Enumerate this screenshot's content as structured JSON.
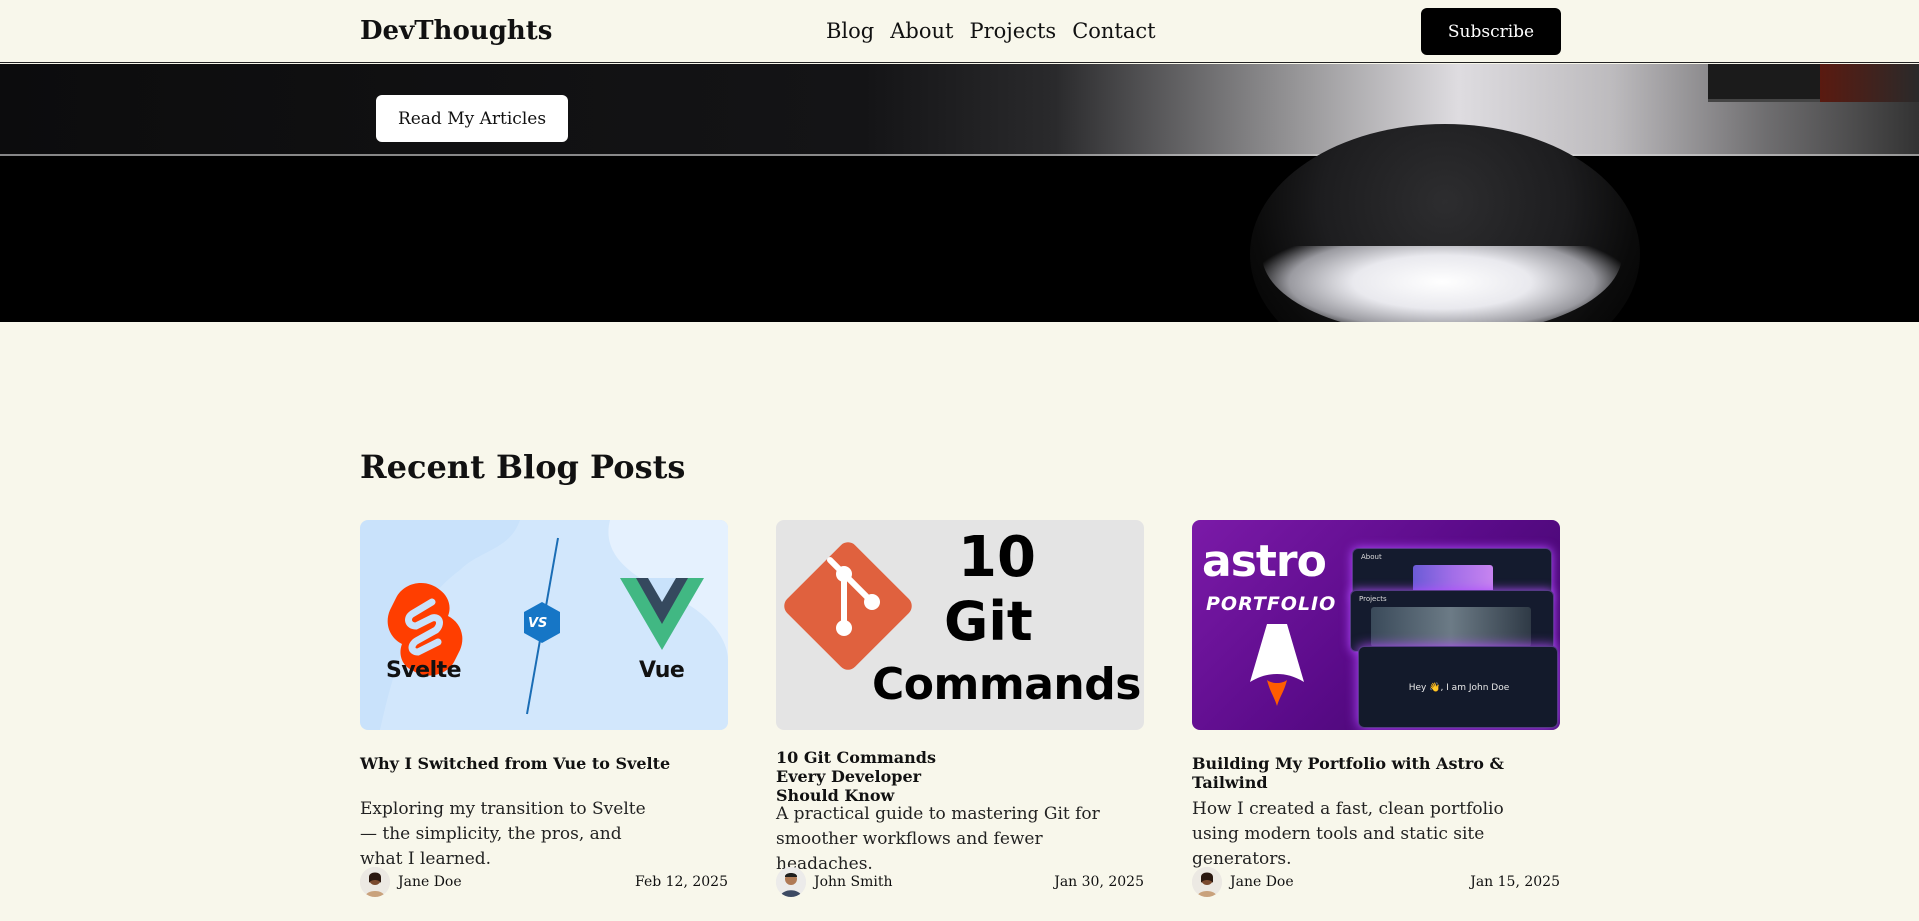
{
  "header": {
    "brand": "DevThoughts",
    "nav": [
      "Blog",
      "About",
      "Projects",
      "Contact"
    ],
    "subscribe_label": "Subscribe"
  },
  "hero": {
    "cta_label": "Read My Articles"
  },
  "section": {
    "title": "Recent Blog Posts"
  },
  "posts": [
    {
      "title": "Why I Switched from Vue to Svelte",
      "description": "Exploring my transition to Svelte — the simplicity, the pros, and what I learned.",
      "author": "Jane Doe",
      "date": "Feb 12, 2025",
      "thumb": {
        "left_label": "Svelte",
        "mid_label": "VS",
        "right_label": "Vue"
      }
    },
    {
      "title": "10 Git Commands Every Developer Should Know",
      "description": "A practical guide to mastering Git for smoother workflows and fewer headaches.",
      "author": "John Smith",
      "date": "Jan 30, 2025",
      "thumb": {
        "line1": "10",
        "line2": "Git",
        "line3": "Commands"
      }
    },
    {
      "title": "Building My Portfolio with Astro & Tailwind",
      "description": "How I created a fast, clean portfolio using modern tools and static site generators.",
      "author": "Jane Doe",
      "date": "Jan 15, 2025",
      "thumb": {
        "logo": "astro",
        "sub": "PORTFOLIO",
        "screen1": "About",
        "screen2": "Projects",
        "greeting": "Hey 👋, I am John Doe"
      }
    }
  ],
  "colors": {
    "background": "#f8f7eb",
    "accent": "#000000",
    "svelte": "#ff3e00",
    "vue_green": "#41b883",
    "vue_dark": "#35495e",
    "git": "#e0613e",
    "astro_purple": "#5b0b8a"
  }
}
